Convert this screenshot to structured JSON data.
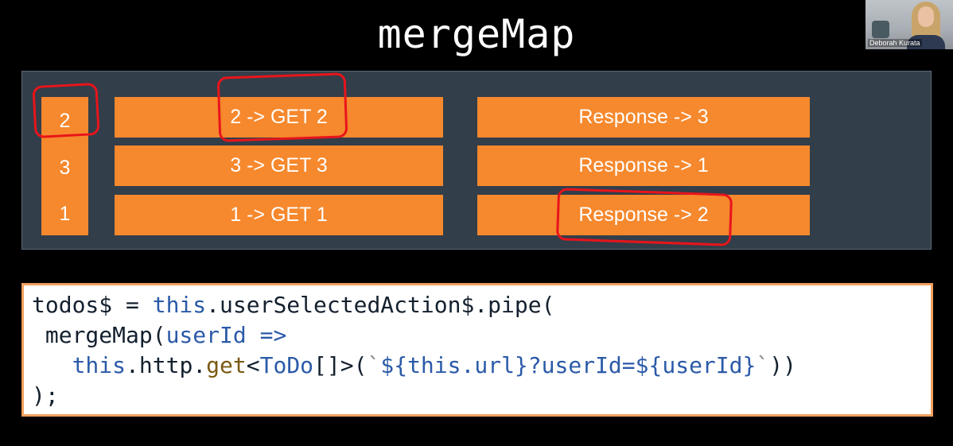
{
  "title": "mergeMap",
  "video": {
    "name": "Deborah Kurata"
  },
  "diagram": {
    "column": [
      "2",
      "3",
      "1"
    ],
    "requests": [
      "2 -> GET 2",
      "3 -> GET 3",
      "1 -> GET 1"
    ],
    "responses": [
      "Response -> 3",
      "Response -> 1",
      "Response -> 2"
    ],
    "highlight_color": "#e8141b",
    "box_color": "#f6882d"
  },
  "code": {
    "line1": {
      "a": "todos$ = ",
      "b": "this",
      "c": ".userSelectedAction$.pipe("
    },
    "line2": {
      "a": " mergeMap(",
      "b": "userId",
      "c": " =>"
    },
    "line3": {
      "a": "this",
      "b": ".http.",
      "c": "get",
      "d": "<",
      "e": "ToDo",
      "f": "[]>(",
      "g": "`",
      "h": "${",
      "i": "this",
      "j": ".url}?userId=${userId}",
      "k": "`",
      "l": "))"
    },
    "line4": ");"
  }
}
